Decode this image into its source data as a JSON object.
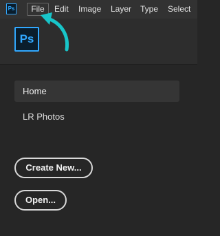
{
  "app": {
    "icon_small_text": "Ps",
    "logo_large_text": "Ps",
    "accent_color": "#31a8ff"
  },
  "menubar": {
    "items": [
      {
        "label": "File"
      },
      {
        "label": "Edit"
      },
      {
        "label": "Image"
      },
      {
        "label": "Layer"
      },
      {
        "label": "Type"
      },
      {
        "label": "Select"
      }
    ]
  },
  "sidebar": {
    "items": [
      {
        "label": "Home",
        "selected": true
      },
      {
        "label": "LR Photos",
        "selected": false
      }
    ]
  },
  "actions": {
    "create_new_label": "Create New...",
    "open_label": "Open..."
  },
  "annotation": {
    "arrow_icon": "curved-arrow-pointing-to-file-menu",
    "arrow_color": "#18c5c9"
  }
}
